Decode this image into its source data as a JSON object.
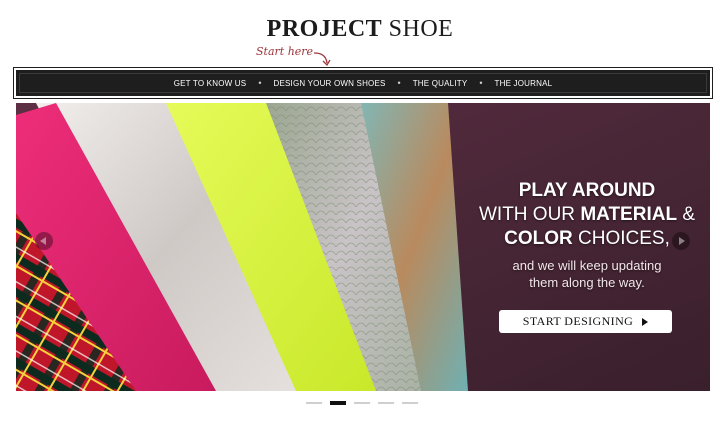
{
  "brand": {
    "logo_bold": "PROJECT",
    "logo_light": "SHOE",
    "tagline": "Start here"
  },
  "nav": {
    "items": [
      {
        "label": "GET TO KNOW US"
      },
      {
        "label": "DESIGN YOUR OWN SHOES"
      },
      {
        "label": "THE QUALITY"
      },
      {
        "label": "THE JOURNAL"
      }
    ],
    "separator": "•"
  },
  "hero": {
    "line1": "PLAY AROUND",
    "line2_pre": "WITH OUR ",
    "line2_bold": "MATERIAL",
    "line2_post": " &",
    "line3_bold": "COLOR",
    "line3_post": " CHOICES,",
    "subtext_1": "and we will keep updating",
    "subtext_2": "them along the way.",
    "cta_label": "START DESIGNING",
    "icons": {
      "prev": "chevron-left-icon",
      "next": "chevron-right-icon",
      "cta": "play-triangle-icon"
    },
    "colors": {
      "pink": "#e0246f",
      "neon": "#d8f532",
      "silver": "#d8d3cf",
      "background": "#4c2a3a"
    }
  },
  "slider": {
    "slide_count": 5,
    "active_index": 1
  }
}
